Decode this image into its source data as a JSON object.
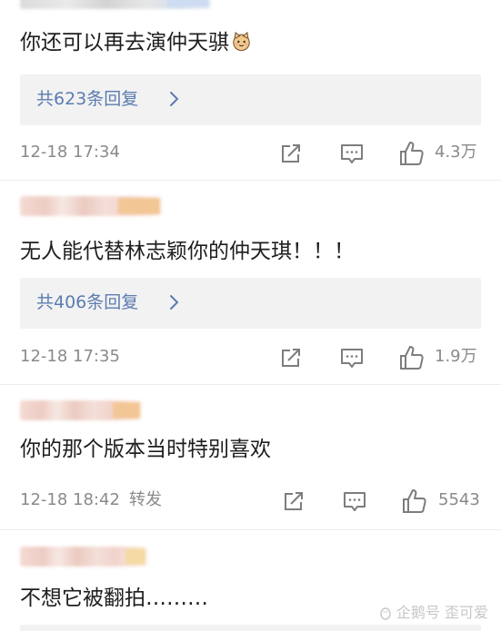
{
  "comments": [
    {
      "content": "你还可以再去演仲天骐",
      "emoji": "cat-face-emoji",
      "replies_label": "共623条回复",
      "time": "12-18 17:34",
      "repost_label": "",
      "likes": "4.3万"
    },
    {
      "content": "无人能代替林志颖你的仲天琪！！！",
      "replies_label": "共406条回复",
      "time": "12-18 17:35",
      "repost_label": "",
      "likes": "1.9万"
    },
    {
      "content": "你的那个版本当时特别喜欢",
      "time": "12-18 18:42",
      "repost_label": "转发",
      "likes": "5543"
    },
    {
      "content": "不想它被翻拍………"
    }
  ],
  "watermark": {
    "text": "企鹅号 歪可爱",
    "icon": "penguin-logo-icon"
  },
  "colors": {
    "link": "#5b7cb1",
    "meta": "#8a8a8a",
    "reply_bg": "#f2f2f2"
  },
  "icons": [
    "share-icon",
    "comment-icon",
    "like-icon",
    "chevron-right-icon"
  ]
}
